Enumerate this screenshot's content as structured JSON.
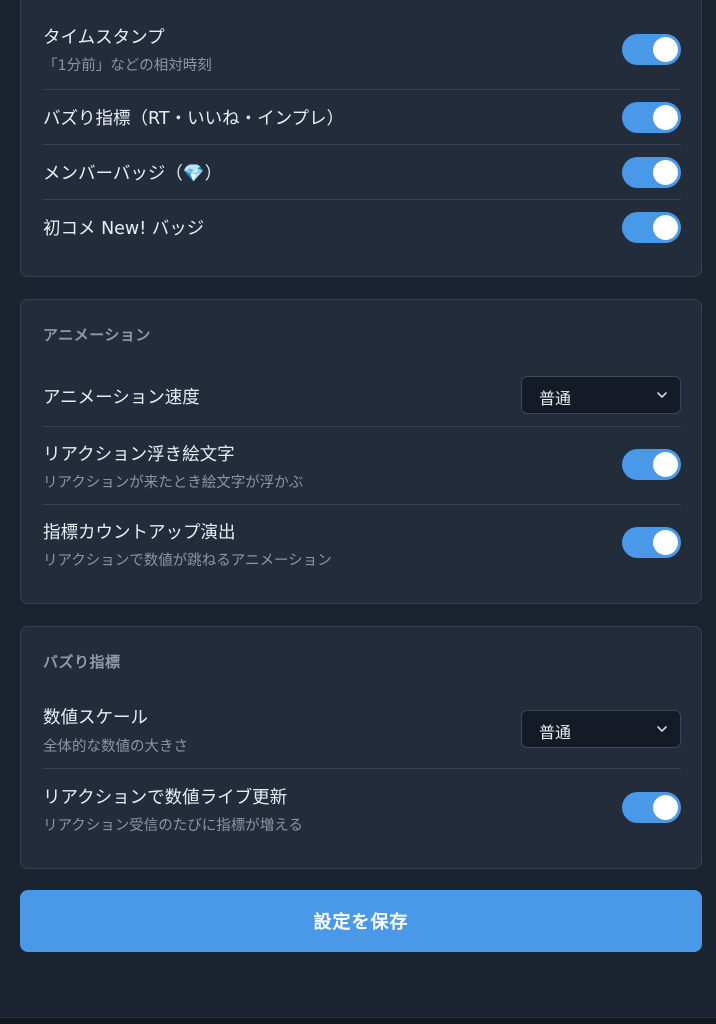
{
  "display_section": {
    "rows": [
      {
        "label": "タイムスタンプ",
        "sub": "「1分前」などの相対時刻",
        "enabled": true
      },
      {
        "label": "バズり指標（RT・いいね・インプレ）",
        "enabled": true
      },
      {
        "label": "メンバーバッジ（💎）",
        "enabled": true
      },
      {
        "label": "初コメ New! バッジ",
        "enabled": true
      }
    ]
  },
  "animation_section": {
    "title": "アニメーション",
    "speed": {
      "label": "アニメーション速度",
      "value": "普通"
    },
    "reaction_emoji": {
      "label": "リアクション浮き絵文字",
      "sub": "リアクションが来たとき絵文字が浮かぶ",
      "enabled": true
    },
    "countup": {
      "label": "指標カウントアップ演出",
      "sub": "リアクションで数値が跳ねるアニメーション",
      "enabled": true
    }
  },
  "buzz_section": {
    "title": "バズり指標",
    "scale": {
      "label": "数値スケール",
      "sub": "全体的な数値の大きさ",
      "value": "普通"
    },
    "live_update": {
      "label": "リアクションで数値ライブ更新",
      "sub": "リアクション受信のたびに指標が増える",
      "enabled": true
    }
  },
  "save_button": {
    "label": "設定を保存"
  },
  "colors": {
    "accent": "#4a98e8",
    "background": "#1b2330",
    "card": "#222c3b"
  },
  "icons": {
    "dropdown": "chevron-down-icon"
  }
}
